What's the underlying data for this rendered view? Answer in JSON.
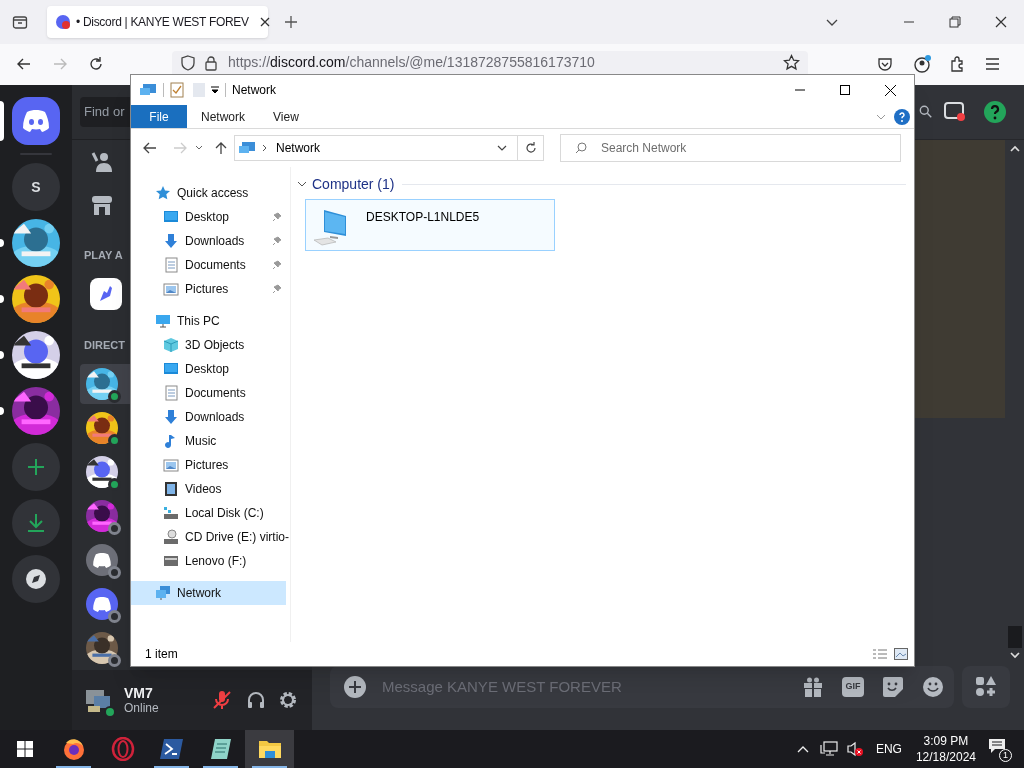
{
  "browser": {
    "tab": {
      "title": "• Discord | KANYE WEST FOREV"
    },
    "url": {
      "scheme": "https://",
      "domain": "discord.com",
      "path": "/channels/@me/1318728755816173710"
    }
  },
  "discord": {
    "servers": [
      {
        "kind": "home",
        "selected": true,
        "unread": false
      },
      {
        "kind": "letter",
        "label": "S",
        "selected": false,
        "unread": false
      },
      {
        "kind": "picture",
        "selected": false,
        "unread": true
      },
      {
        "kind": "picture",
        "selected": false,
        "unread": true
      },
      {
        "kind": "picture",
        "selected": false,
        "unread": true
      },
      {
        "kind": "picture",
        "selected": false,
        "unread": true
      },
      {
        "kind": "add",
        "selected": false,
        "unread": false
      },
      {
        "kind": "download",
        "selected": false,
        "unread": false
      },
      {
        "kind": "discover",
        "selected": false,
        "unread": false
      }
    ],
    "search": {
      "placeholder": "Find or"
    },
    "activity_header": "PLAY A",
    "dm_header": "DIRECT",
    "dms": [
      {
        "kind": "picture",
        "online": true,
        "selected": true
      },
      {
        "kind": "picture",
        "online": true,
        "selected": false
      },
      {
        "kind": "picture",
        "online": true,
        "selected": false
      },
      {
        "kind": "picture",
        "online": false,
        "selected": false
      },
      {
        "kind": "logo",
        "color": "#6d6f78",
        "online": false,
        "selected": false
      },
      {
        "kind": "logo",
        "color": "#5865f2",
        "online": false,
        "selected": false
      },
      {
        "kind": "picture",
        "online": false,
        "selected": false
      }
    ],
    "user": {
      "name": "VM7",
      "status": "Online",
      "mic_muted": true
    },
    "composer": {
      "placeholder": "Message KANYE WEST FOREVER",
      "buttons": [
        {
          "kind": "gift"
        },
        {
          "kind": "gif",
          "label": "GIF"
        },
        {
          "kind": "sticker"
        },
        {
          "kind": "emoji"
        }
      ]
    }
  },
  "explorer": {
    "title": "Network",
    "ribbon_tabs": [
      {
        "label": "File",
        "selected": true
      },
      {
        "label": "Network",
        "selected": false
      },
      {
        "label": "View",
        "selected": false
      }
    ],
    "address": {
      "path": "Network"
    },
    "search": {
      "placeholder": "Search Network"
    },
    "nav": [
      {
        "label": "Quick access",
        "kind": "star",
        "selected": false,
        "pinned": false,
        "children": [
          {
            "label": "Desktop",
            "kind": "desktop",
            "selected": false,
            "pinned": true
          },
          {
            "label": "Downloads",
            "kind": "downloads",
            "selected": false,
            "pinned": true
          },
          {
            "label": "Documents",
            "kind": "documents",
            "selected": false,
            "pinned": true
          },
          {
            "label": "Pictures",
            "kind": "pictures",
            "selected": false,
            "pinned": true
          }
        ]
      },
      {
        "label": "This PC",
        "kind": "pc",
        "selected": false,
        "pinned": false,
        "children": [
          {
            "label": "3D Objects",
            "kind": "objects",
            "selected": false,
            "pinned": false
          },
          {
            "label": "Desktop",
            "kind": "desktop",
            "selected": false,
            "pinned": false
          },
          {
            "label": "Documents",
            "kind": "documents",
            "selected": false,
            "pinned": false
          },
          {
            "label": "Downloads",
            "kind": "downloads",
            "selected": false,
            "pinned": false
          },
          {
            "label": "Music",
            "kind": "music",
            "selected": false,
            "pinned": false
          },
          {
            "label": "Pictures",
            "kind": "pictures",
            "selected": false,
            "pinned": false
          },
          {
            "label": "Videos",
            "kind": "videos",
            "selected": false,
            "pinned": false
          },
          {
            "label": "Local Disk (C:)",
            "kind": "disk",
            "selected": false,
            "pinned": false
          },
          {
            "label": "CD Drive (E:) virtio-",
            "kind": "cd",
            "selected": false,
            "pinned": false
          },
          {
            "label": "Lenovo (F:)",
            "kind": "usb",
            "selected": false,
            "pinned": false
          }
        ]
      },
      {
        "label": "Network",
        "kind": "network",
        "selected": true,
        "pinned": false
      }
    ],
    "groups": [
      {
        "label": "Computer (1)",
        "expanded": true,
        "items": [
          {
            "label": "DESKTOP-L1NLDE5",
            "selected": true
          }
        ]
      }
    ],
    "status": "1 item"
  },
  "taskbar": {
    "apps": [
      {
        "kind": "start",
        "running": false,
        "active": false
      },
      {
        "kind": "firefox",
        "running": true,
        "active": false
      },
      {
        "kind": "opera",
        "running": false,
        "active": false
      },
      {
        "kind": "powershell",
        "running": true,
        "active": false
      },
      {
        "kind": "notepad",
        "running": true,
        "active": false
      },
      {
        "kind": "explorer",
        "running": true,
        "active": true
      }
    ],
    "tray": {
      "language": "ENG",
      "time": "3:09 PM",
      "date": "12/18/2024",
      "notifications": "1"
    }
  }
}
